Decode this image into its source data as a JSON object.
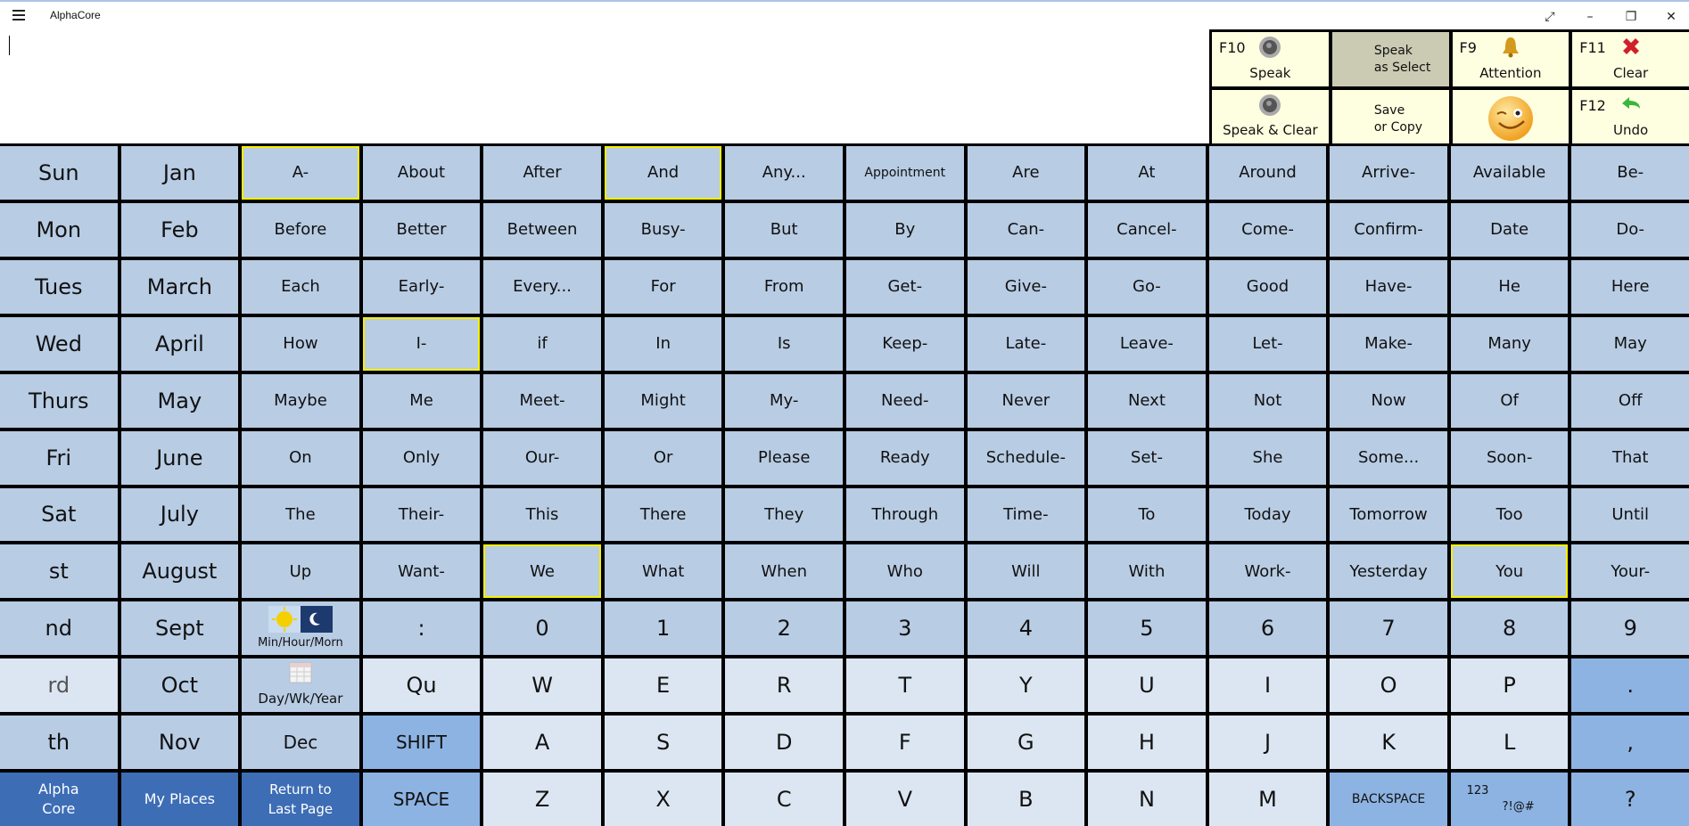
{
  "window": {
    "title": "AlphaCore",
    "menu_icon": "hamburger-icon",
    "controls": [
      "expand-icon",
      "minimize-icon",
      "restore-icon",
      "close-icon"
    ]
  },
  "editor": {
    "value": ""
  },
  "function_keys": [
    {
      "key": "F10",
      "label": "Speak",
      "icon": "speaker-icon"
    },
    {
      "key": "",
      "label": "Speak\nas Select",
      "icon": ""
    },
    {
      "key": "F9",
      "label": "Attention",
      "icon": "bell-icon"
    },
    {
      "key": "F11",
      "label": "Clear",
      "icon": "red-x-icon"
    },
    {
      "key": "",
      "label": "Speak & Clear",
      "icon": "speaker-icon"
    },
    {
      "key": "",
      "label": "Save\nor Copy",
      "icon": ""
    },
    {
      "key": "",
      "label": "",
      "icon": "winking-smiley-icon"
    },
    {
      "key": "F12",
      "label": "Undo",
      "icon": "green-undo-arrow-icon"
    }
  ],
  "fk_text": {
    "speak_as_select_1": "Speak",
    "speak_as_select_2": "as Select",
    "save_copy_1": "Save",
    "save_copy_2": "or Copy"
  },
  "grid": {
    "rows": [
      [
        "Sun",
        "Jan",
        "A-",
        "About",
        "After",
        "And",
        "Any...",
        "Appointment",
        "Are",
        "At",
        "Around",
        "Arrive-",
        "Available",
        "Be-"
      ],
      [
        "Mon",
        "Feb",
        "Before",
        "Better",
        "Between",
        "Busy-",
        "But",
        "By",
        "Can-",
        "Cancel-",
        "Come-",
        "Confirm-",
        "Date",
        "Do-"
      ],
      [
        "Tues",
        "March",
        "Each",
        "Early-",
        "Every...",
        "For",
        "From",
        "Get-",
        "Give-",
        "Go-",
        "Good",
        "Have-",
        "He",
        "Here"
      ],
      [
        "Wed",
        "April",
        "How",
        "I-",
        "if",
        "In",
        "Is",
        "Keep-",
        "Late-",
        "Leave-",
        "Let-",
        "Make-",
        "Many",
        "May"
      ],
      [
        "Thurs",
        "May",
        "Maybe",
        "Me",
        "Meet-",
        "Might",
        "My-",
        "Need-",
        "Never",
        "Next",
        "Not",
        "Now",
        "Of",
        "Off"
      ],
      [
        "Fri",
        "June",
        "On",
        "Only",
        "Our-",
        "Or",
        "Please",
        "Ready",
        "Schedule-",
        "Set-",
        "She",
        "Some...",
        "Soon-",
        "That"
      ],
      [
        "Sat",
        "July",
        "The",
        "Their-",
        "This",
        "There",
        "They",
        "Through",
        "Time-",
        "To",
        "Today",
        "Tomorrow",
        "Too",
        "Until"
      ],
      [
        "st",
        "August",
        "Up",
        "Want-",
        "We",
        "What",
        "When",
        "Who",
        "Will",
        "With",
        "Work-",
        "Yesterday",
        "You",
        "Your-"
      ],
      [
        "nd",
        "Sept",
        "Min/Hour/Morn",
        ":",
        "0",
        "1",
        "2",
        "3",
        "4",
        "5",
        "6",
        "7",
        "8",
        "9"
      ],
      [
        "rd",
        "Oct",
        "Day/Wk/Year",
        "Qu",
        "W",
        "E",
        "R",
        "T",
        "Y",
        "U",
        "I",
        "O",
        "P",
        "."
      ],
      [
        "th",
        "Nov",
        "Dec",
        "SHIFT",
        "A",
        "S",
        "D",
        "F",
        "G",
        "H",
        "J",
        "K",
        "L",
        ","
      ],
      [
        "Alpha Core",
        "My Places",
        "Return to Last Page",
        "SPACE",
        "Z",
        "X",
        "C",
        "V",
        "B",
        "N",
        "M",
        "BACKSPACE",
        "123 ?!@#",
        "?"
      ]
    ],
    "highlighted": [
      "A-",
      "And",
      "I-",
      "We",
      "You"
    ],
    "special_labels": {
      "alpha_core_1": "Alpha",
      "alpha_core_2": "Core",
      "return_1": "Return to",
      "return_2": "Last Page",
      "sym_1": "123",
      "sym_2": "?!@#"
    }
  },
  "colors": {
    "cell": "#b8cce4",
    "letter_cell": "#dce6f2",
    "action_cell": "#8db3e2",
    "nav_cell": "#3d6db5",
    "function_cell": "#fefee0",
    "highlight_border": "#f5f000"
  }
}
